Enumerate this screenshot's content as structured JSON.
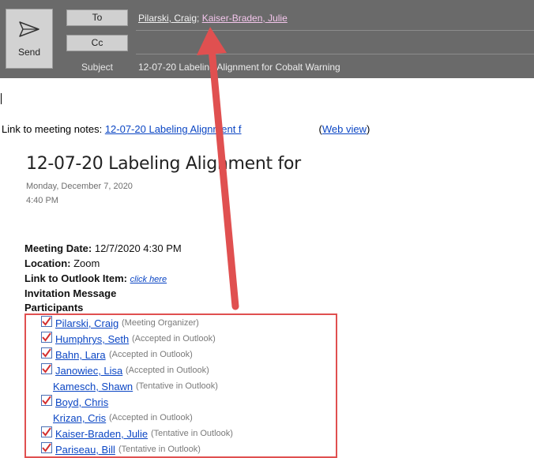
{
  "compose": {
    "send_label": "Send",
    "to_label": "To",
    "cc_label": "Cc",
    "subject_label": "Subject",
    "recipients": [
      "Pilarski, Craig",
      "Kaiser-Braden, Julie"
    ],
    "recipient_separator": ";",
    "subject_value": "12-07-20 Labeling Alignment for Cobalt Warning"
  },
  "body": {
    "notes_prefix": "Link to meeting notes: ",
    "notes_link": "12-07-20 Labeling Alignment f",
    "web_view_open": "(",
    "web_view_link": "Web view",
    "web_view_close": ")",
    "meeting_title": "12-07-20 Labeling Alignment for",
    "meeting_date_small": "Monday, December 7, 2020",
    "meeting_time_small": "4:40 PM",
    "meeting_date_label": "Meeting Date:",
    "meeting_date_value": " 12/7/2020  4:30 PM",
    "location_label": "Location:",
    "location_value": " Zoom",
    "outlook_item_label": "Link to Outlook Item:",
    "outlook_item_link": "click here",
    "invitation_label": "Invitation Message",
    "participants_label": "Participants"
  },
  "participants": [
    {
      "name": "Pilarski, Craig",
      "status": "(Meeting Organizer)",
      "checked": true
    },
    {
      "name": "Humphrys, Seth",
      "status": "(Accepted in Outlook)",
      "checked": true
    },
    {
      "name": "Bahn, Lara",
      "status": "(Accepted in Outlook)",
      "checked": true
    },
    {
      "name": "Janowiec, Lisa",
      "status": "(Accepted in Outlook)",
      "checked": true
    },
    {
      "name": "Kamesch, Shawn",
      "status": "(Tentative  in Outlook)",
      "checked": false
    },
    {
      "name": "Boyd, Chris",
      "status": "",
      "checked": true
    },
    {
      "name": "Krizan, Cris",
      "status": "(Accepted in Outlook)",
      "checked": false
    },
    {
      "name": "Kaiser-Braden, Julie",
      "status": "(Tentative in Outlook)",
      "checked": true
    },
    {
      "name": "Pariseau, Bill",
      "status": "(Tentative in Outlook)",
      "checked": true
    }
  ],
  "colors": {
    "header_bg": "#6a6a6a",
    "link_blue": "#0b46c4",
    "annotation_red": "#e05050"
  }
}
